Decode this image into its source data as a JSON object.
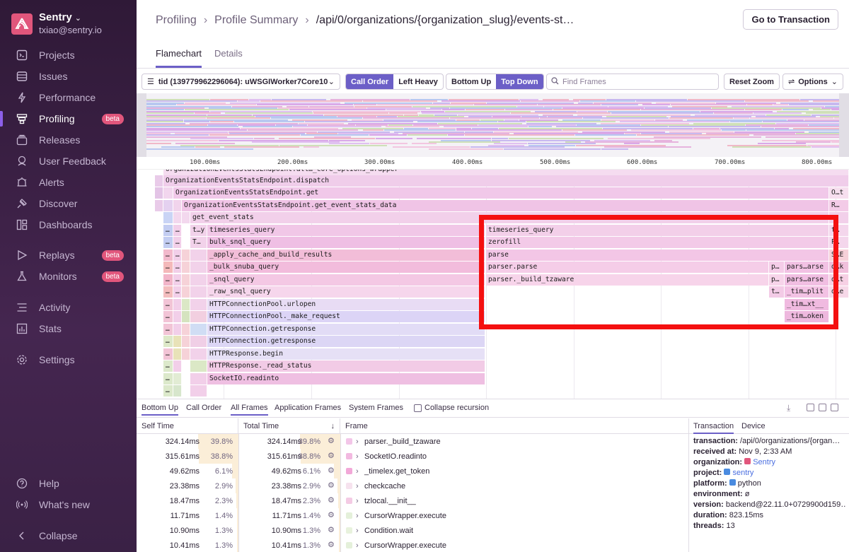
{
  "sidebar": {
    "org_name": "Sentry",
    "org_user": "txiao@sentry.io",
    "items": [
      {
        "label": "Projects",
        "icon": "projects-icon"
      },
      {
        "label": "Issues",
        "icon": "issues-icon"
      },
      {
        "label": "Performance",
        "icon": "performance-icon"
      },
      {
        "label": "Profiling",
        "icon": "profiling-icon",
        "badge": "beta",
        "active": true
      },
      {
        "label": "Releases",
        "icon": "releases-icon"
      },
      {
        "label": "User Feedback",
        "icon": "feedback-icon"
      },
      {
        "label": "Alerts",
        "icon": "alerts-icon"
      },
      {
        "label": "Discover",
        "icon": "discover-icon"
      },
      {
        "label": "Dashboards",
        "icon": "dashboards-icon"
      },
      {
        "label": "Replays",
        "icon": "replays-icon",
        "badge": "beta"
      },
      {
        "label": "Monitors",
        "icon": "monitors-icon",
        "badge": "beta"
      },
      {
        "label": "Activity",
        "icon": "activity-icon"
      },
      {
        "label": "Stats",
        "icon": "stats-icon"
      },
      {
        "label": "Settings",
        "icon": "settings-icon"
      }
    ],
    "footer": [
      {
        "label": "Help",
        "icon": "help-icon"
      },
      {
        "label": "What's new",
        "icon": "broadcast-icon"
      },
      {
        "label": "Collapse",
        "icon": "collapse-icon"
      }
    ]
  },
  "header": {
    "breadcrumbs": [
      "Profiling",
      "Profile Summary",
      "/api/0/organizations/{organization_slug}/events-st…"
    ],
    "goto_button": "Go to Transaction",
    "tabs": [
      "Flamechart",
      "Details"
    ]
  },
  "toolbar": {
    "thread": "tid (139779962296064): uWSGIWorker7Core10",
    "order": [
      "Call Order",
      "Left Heavy"
    ],
    "direction": [
      "Bottom Up",
      "Top Down"
    ],
    "find_placeholder": "Find Frames",
    "reset_zoom": "Reset Zoom",
    "options": "Options"
  },
  "axis_ticks": [
    "100.00ms",
    "200.00ms",
    "300.00ms",
    "400.00ms",
    "500.00ms",
    "600.00ms",
    "700.00ms",
    "800.00ms"
  ],
  "flame_frames": [
    "OrganizationEventsStatsEndpoint.dispatch",
    "OrganizationEventsStatsEndpoint.get",
    "OrganizationEventsStatsEndpoint.get_event_stats_data",
    "get_event_stats",
    "timeseries_query",
    "bulk_snql_query",
    "_apply_cache_and_build_results",
    "_bulk_snuba_query",
    "_snql_query",
    "_raw_snql_query",
    "HTTPConnectionPool.urlopen",
    "HTTPConnectionPool._make_request",
    "HTTPConnection.getresponse",
    "HTTPConnection.getresponse",
    "HTTPResponse.begin",
    "HTTPResponse._read_status",
    "SocketIO.readinto",
    "timeseries_query",
    "zerofill",
    "parse",
    "parser.parse",
    "parser._build_tzaware",
    "pars…arse",
    "pars…arse",
    "_tim…plit",
    "_tim…xt__",
    "_tim…oken",
    "OrganizationEventsStatsEndpoint.all…_core_options_wrapper"
  ],
  "bottom": {
    "view_tabs": [
      "Bottom Up",
      "Call Order"
    ],
    "frame_tabs": [
      "All Frames",
      "Application Frames",
      "System Frames"
    ],
    "collapse_label": "Collapse recursion",
    "columns": [
      "Self Time",
      "Total Time",
      "Frame"
    ],
    "rows": [
      {
        "self": "324.14ms",
        "self_pct": "39.8%",
        "total": "324.14ms",
        "total_pct": "39.8%",
        "frame": "parser._build_tzaware",
        "color": "#f3c6e8"
      },
      {
        "self": "315.61ms",
        "self_pct": "38.8%",
        "total": "315.61ms",
        "total_pct": "38.8%",
        "frame": "SocketIO.readinto",
        "color": "#f2b9e0"
      },
      {
        "self": "49.62ms",
        "self_pct": "6.1%",
        "total": "49.62ms",
        "total_pct": "6.1%",
        "frame": "_timelex.get_token",
        "color": "#f2a8d8"
      },
      {
        "self": "23.38ms",
        "self_pct": "2.9%",
        "total": "23.38ms",
        "total_pct": "2.9%",
        "frame": "checkcache",
        "color": "#f6e2ee"
      },
      {
        "self": "18.47ms",
        "self_pct": "2.3%",
        "total": "18.47ms",
        "total_pct": "2.3%",
        "frame": "tzlocal.__init__",
        "color": "#f4cbe4"
      },
      {
        "self": "11.71ms",
        "self_pct": "1.4%",
        "total": "11.71ms",
        "total_pct": "1.4%",
        "frame": "CursorWrapper.execute",
        "color": "#e4f0da"
      },
      {
        "self": "10.90ms",
        "self_pct": "1.3%",
        "total": "10.90ms",
        "total_pct": "1.3%",
        "frame": "Condition.wait",
        "color": "#e8f2dd"
      },
      {
        "self": "10.41ms",
        "self_pct": "1.3%",
        "total": "10.41ms",
        "total_pct": "1.3%",
        "frame": "CursorWrapper.execute",
        "color": "#e4f0da"
      }
    ],
    "details_tabs": [
      "Transaction",
      "Device"
    ],
    "details": [
      {
        "key": "transaction:",
        "value": "/api/0/organizations/{organ…"
      },
      {
        "key": "received at:",
        "value": "Nov 9, 2:33 AM"
      },
      {
        "key": "organization:",
        "value": "Sentry"
      },
      {
        "key": "project:",
        "value": "sentry"
      },
      {
        "key": "platform:",
        "value": "python"
      },
      {
        "key": "environment:",
        "value": "ø"
      },
      {
        "key": "version:",
        "value": "backend@22.11.0+0729900d159…"
      },
      {
        "key": "duration:",
        "value": "823.15ms"
      },
      {
        "key": "threads:",
        "value": "13"
      }
    ]
  }
}
